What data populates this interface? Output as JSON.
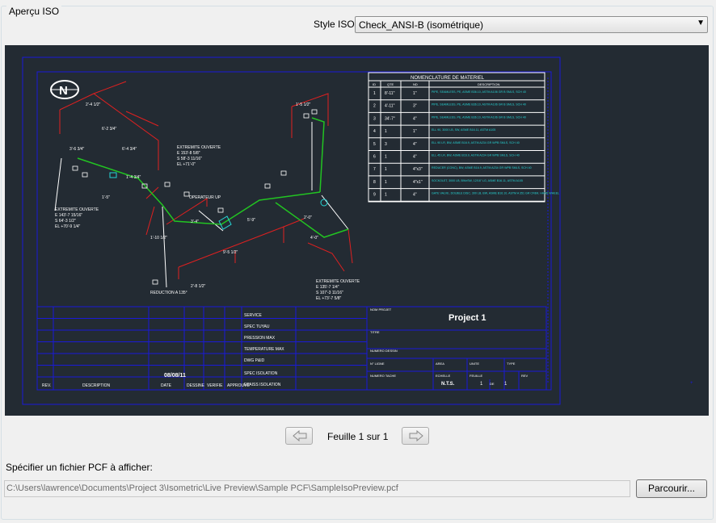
{
  "group_title": "Aperçu ISO",
  "style_row": {
    "label": "Style ISO:",
    "selected": "Check_ANSI-B (isométrique)"
  },
  "drawing": {
    "table_title": "NOMENCLATURE DE MATERIEL",
    "table_headers": [
      "ID",
      "QTE",
      "ND",
      "DESCRIPTION"
    ],
    "table_rows": [
      {
        "id": "1",
        "qte": "8'-11\"",
        "nd": "1\"",
        "desc": "PIPE, SEAMLESS, PE, ASME B36.10, ASTM A106 GR B SMLS, SCH 40"
      },
      {
        "id": "2",
        "qte": "4'-11\"",
        "nd": "3\"",
        "desc": "PIPE, SEAMLESS, PE, ASME B36.10, ASTM A106 GR B SMLS, SCH 40"
      },
      {
        "id": "3",
        "qte": "34'-7\"",
        "nd": "4\"",
        "desc": "PIPE, SEAMLESS, PE, ASME B36.10, ASTM A106 GR B SMLS, SCH 40"
      },
      {
        "id": "4",
        "qte": "1",
        "nd": "1\"",
        "desc": "ELL 90, 3000 LB, SW, ASME B16.11, ASTM A105"
      },
      {
        "id": "5",
        "qte": "3",
        "nd": "4\"",
        "desc": "ELL 90 LR, BW, ASME B16.9, ASTM A234 GR WPB SMLS, SCH 40"
      },
      {
        "id": "6",
        "qte": "1",
        "nd": "4\"",
        "desc": "ELL 45 LR, BW, ASME B16.9, ASTM A234 GR WPB SMLS, SCH 40"
      },
      {
        "id": "7",
        "qte": "1",
        "nd": "4\"x3\"",
        "desc": "REDUCER (CONC), BW, ASME B16.9, ASTM A234 GR WPB SMLS, SCH 40"
      },
      {
        "id": "8",
        "qte": "1",
        "nd": "4\"x1\"",
        "desc": "SOCKOLET, 3000 LB, BWxSW, 12/16\" LG, ASME B16.11, ASTM A105"
      },
      {
        "id": "9",
        "qte": "1",
        "nd": "4\"",
        "desc": "GATE VALVE, DOUBLE DISC, 300 LB, BW, ASME B16.10, ASTM A 351 GR CF8M, HAND WHEEL"
      }
    ],
    "north": "N",
    "project": "Project 1",
    "date_value": "08/08/11",
    "rev_headers": [
      "REV.",
      "DESCRIPTION",
      "DATE",
      "DESSINE",
      "VERIFIE",
      "APPROUVE"
    ],
    "fields": [
      "SERVICE",
      "SPEC TUYAU",
      "PRESSION MAX",
      "TEMPERATURE MAX",
      "DWG P&ID",
      "SPEC ISOLATION",
      "EPAISS ISOLATION"
    ],
    "right_labels": {
      "nom_projet": "NOM PROJET",
      "titre": "TITRE",
      "numero_dessin": "NUMERO DESSIN",
      "no_ligne": "N° LIGNE",
      "area": "AREA",
      "unite": "UNITE",
      "type": "TYPE",
      "numero_tache": "NUMERO TACHE",
      "echelle": "ECHELLE",
      "feuille": "FEUILLE",
      "rev": "REV"
    },
    "scale_value": "N.T.S.",
    "sheet_a": "1",
    "sheet_de": "DE",
    "sheet_b": "1",
    "annotations": {
      "ext_top": [
        "EXTREMITE OUVERTE",
        "E 153'-8 5/8\"",
        "S 58'-3 11/16\"",
        "EL +71'-0\""
      ],
      "ext_left": [
        "EXTREMITE OUVERTE",
        "E 143'-7 15/16\"",
        "S 64'-3 1/2\"",
        "EL +70'-9 1/4\""
      ],
      "ext_right": [
        "EXTREMITE OUVERTE",
        "E 135'-7 1/4\"",
        "S 107'-3 11/16\"",
        "EL +73'-7 5/8\""
      ],
      "operator": "OPERATEUR UP",
      "reduction": "REDUCTION A 135°",
      "dims": [
        "2'-4 1/2\"",
        "6'-2 3/4\"",
        "6'-4 3/4\"",
        "3'-6 3/4\"",
        "1'-4 3/4\"",
        "1'-5\"",
        "5'-9\"",
        "2'-8 1/2\"",
        "1'-10 1/2\"",
        "3'-4\"",
        "9'-5 1/2\"",
        "1'-5 1/2\"",
        "2'-0\"",
        "4'-0\""
      ]
    }
  },
  "navigation": {
    "sheet_label": "Feuille 1 sur 1",
    "prev_icon": "arrow-left-icon",
    "next_icon": "arrow-right-icon"
  },
  "pcf": {
    "label": "Spécifier un fichier PCF à afficher:",
    "path": "C:\\Users\\lawrence\\Documents\\Project 3\\Isometric\\Live Preview\\Sample PCF\\SampleIsoPreview.pcf",
    "browse_label": "Parcourir..."
  },
  "colors": {
    "background": "#232b33",
    "frame": "#1a1ad8",
    "pipe_red": "#e02020",
    "pipe_green": "#22c422",
    "white": "#ffffff",
    "cyan": "#26d6d6"
  }
}
